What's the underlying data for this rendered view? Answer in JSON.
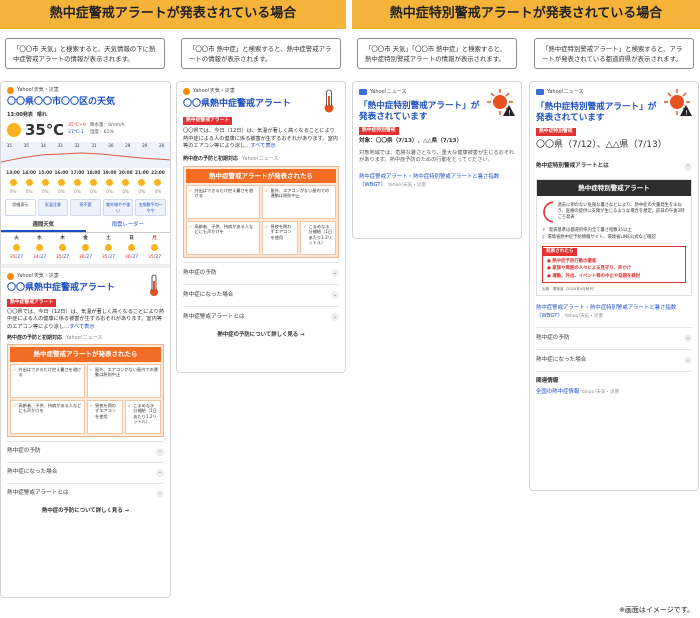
{
  "headers": {
    "left": "熱中症警戒アラートが発表されている場合",
    "right": "熱中症特別警戒アラートが発表されている場合"
  },
  "captions": [
    "「〇〇市 天気」と検索すると、天気情報の下に熱中症警戒アラートの情報が表示されます。",
    "「〇〇市 熱中症」と検索すると、熱中症警戒アラートの情報が表示されます。",
    "「〇〇市 天気」「〇〇市 熱中症」と検索すると、熱中症特別警戒アラートの情報が表示されます。",
    "「熱中症特別警戒アラート」と検索すると、アラートが発表されている都道府県が表示されます。"
  ],
  "common": {
    "yahoo_weather": "Yahoo!天気・災害",
    "yahoo_news": "Yahoo!ニュース",
    "alert_title": "〇〇県熱中症警戒アラート",
    "alert_tag": "熱中症警戒アラート",
    "alert_body": "〇〇県では、今日（12日）は、気温が著しく高くなることにより熱中症による人の健康に係る被害が生ずるおそれがあります。室内等のエアコン等により涼し…",
    "alert_more": "すべて表示",
    "prevent_head": "熱中症の予防と初期対応",
    "panel_head": "熱中症警戒アラートが発表されたら",
    "panel_items": [
      "外出はできるだけ控え暑さを避ける",
      "屋外、エアコンがない屋内での運動は原則中止",
      "高齢者、子供、持病がある人などにも声かけを",
      "昼夜を問わずエアコンを使用",
      "こまめな水分補給（1日あたり1.2リットル）"
    ],
    "acc_items": [
      "熱中症の予防",
      "熱中症になった場合",
      "熱中症警戒アラートとは"
    ],
    "more_link": "熱中症の予防について詳しく見る →"
  },
  "s1": {
    "place": "〇〇県〇〇市〇〇区の天気",
    "time": "13:00発表",
    "weather": "晴れ",
    "temp": "35℃",
    "hi": "35℃+0",
    "lo": "27℃-1",
    "rain": "降水量：0mm/h",
    "humid": "湿度：61%",
    "hours": [
      "13:00",
      "14:00",
      "15:00",
      "16:00",
      "17:00",
      "18:00",
      "19:00",
      "20:00",
      "21:00",
      "22:00"
    ],
    "htemps": [
      "35",
      "35",
      "34",
      "33",
      "32",
      "31",
      "30",
      "29",
      "29",
      "28"
    ],
    "chips": [
      "詳細表示",
      "気温注意",
      "雨不要",
      "紫外線やや強い",
      "虫指数平均〜やや"
    ],
    "tabs": [
      "週間天気",
      "雨雲レーダー"
    ],
    "days": [
      "火",
      "水",
      "木",
      "金",
      "土",
      "日",
      "月"
    ],
    "dhi": [
      "35",
      "34",
      "35",
      "36",
      "35",
      "36",
      "35"
    ],
    "dlo": [
      "27",
      "27",
      "27",
      "27",
      "27",
      "27",
      "27"
    ]
  },
  "s3": {
    "title": "「熱中症特別警戒アラート」が発表されています",
    "tag": "熱中症特別警戒",
    "target": "対象：〇〇県（7/13）、△△県（7/13）",
    "body": "対象地域では、危険な暑さとなり、重大な健康被害が生じるおそれがあります。熱中症予防のための行動をとってください。",
    "link": "熱中症警戒アラート・熱中症特別警戒アラートと暑さ指数（WBGT）",
    "link_src": "Yahoo!天気・災害"
  },
  "s4": {
    "title": "「熱中症特別警戒アラート」が発表されています",
    "tag": "熱中症特別警戒",
    "prefs": "〇〇県（7/12）、△△県（7/13）",
    "about": "熱中症特別警戒アラートとは",
    "panel_title": "熱中症特別警戒アラート",
    "panel_desc": "過去に例のない危険な暑さなどにより、熱中症の大量発生をまねき、医療の提供に支障が生じるような場合を想定。前日の午後2時ごろ発表",
    "panel_b1": "発表基準は都道府県内全て暑さ指数35以上",
    "panel_b2": "環境省熱中症予防情報サイト、環境省LINE公式など確認",
    "panel_red": "発表されたら",
    "panel_r1": "熱中症予防行動の徹底",
    "panel_r2": "家族や周囲の人々による見守り、声かけ",
    "panel_r3": "運動、外出、イベント等の中止や延期を検討",
    "panel_foot": "出典：環境省（2024年4月時代）",
    "link": "熱中症警戒アラート・熱中症特別警戒アラートと暑さ指数（WBGT）",
    "acc": [
      "熱中症の予防",
      "熱中症になった場合"
    ],
    "related": "関連情報",
    "related_link": "全国の熱中症情報",
    "related_src": "Yahoo!天気・災害"
  },
  "note": "※画面はイメージです。",
  "colors": {
    "header": "#f6b33a",
    "link": "#1a4ec2",
    "red": "#e03030",
    "orange": "#f26c24"
  }
}
